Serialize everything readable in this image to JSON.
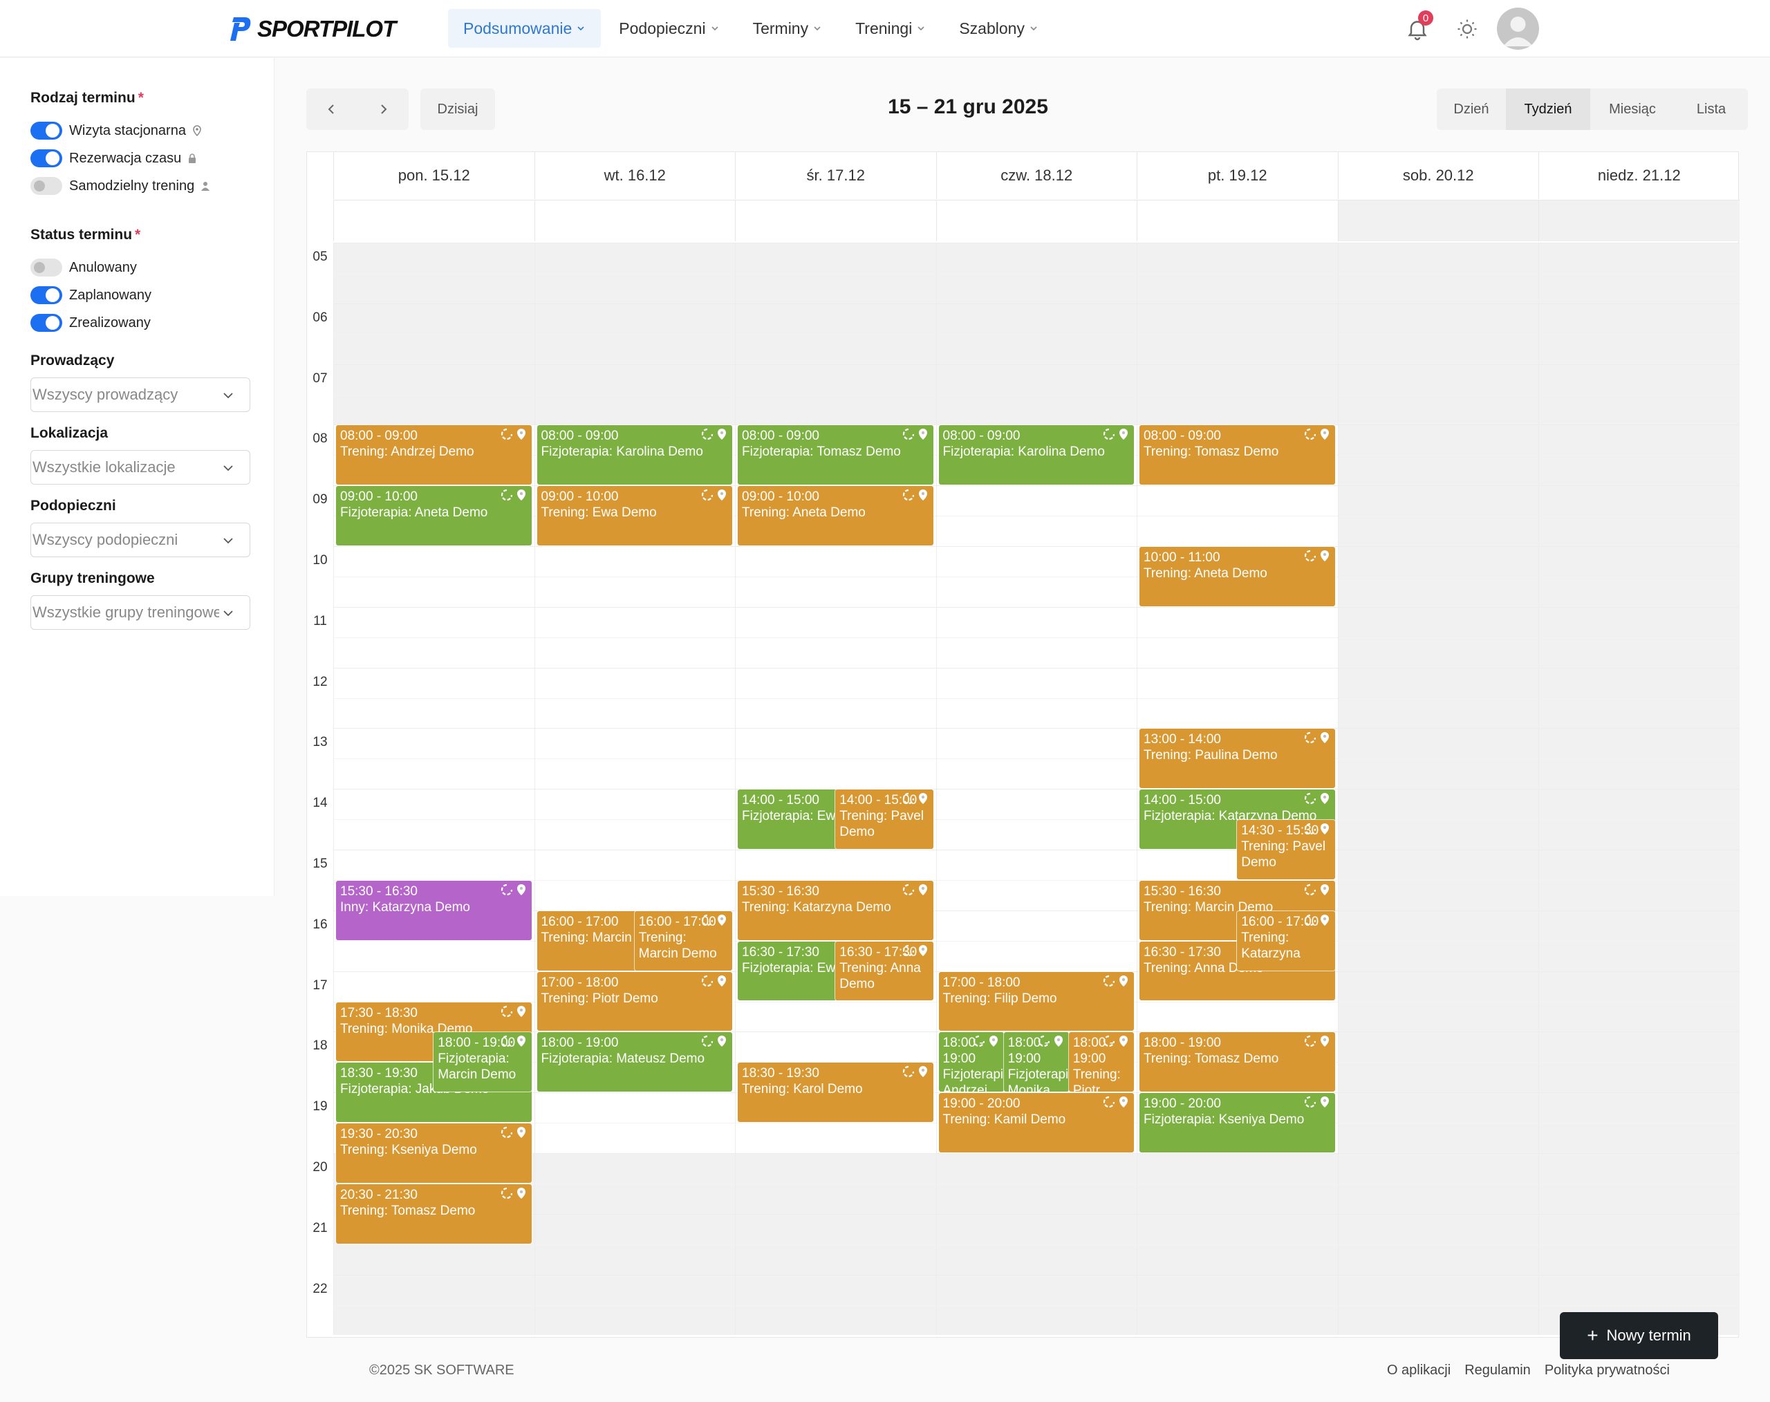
{
  "brand": {
    "name": "SPORTPILOT",
    "color": "#1b6ff0"
  },
  "nav": [
    {
      "label": "Podsumowanie",
      "active": true
    },
    {
      "label": "Podopieczni",
      "active": false
    },
    {
      "label": "Terminy",
      "active": false
    },
    {
      "label": "Treningi",
      "active": false
    },
    {
      "label": "Szablony",
      "active": false
    }
  ],
  "header": {
    "notifications_count": "0",
    "icons": [
      "bell-icon",
      "sun-icon",
      "avatar"
    ]
  },
  "sidebar": {
    "type_title": "Rodzaj terminu",
    "required_mark": "*",
    "types": [
      {
        "label": "Wizyta stacjonarna",
        "on": true,
        "icon": "location-pin-icon"
      },
      {
        "label": "Rezerwacja czasu",
        "on": true,
        "icon": "lock-icon"
      },
      {
        "label": "Samodzielny trening",
        "on": false,
        "icon": "person-icon"
      }
    ],
    "status_title": "Status terminu",
    "statuses": [
      {
        "label": "Anulowany",
        "on": false
      },
      {
        "label": "Zaplanowany",
        "on": true
      },
      {
        "label": "Zrealizowany",
        "on": true
      }
    ],
    "filters": [
      {
        "title": "Prowadzący",
        "placeholder": "Wszyscy prowadzący"
      },
      {
        "title": "Lokalizacja",
        "placeholder": "Wszystkie lokalizacje"
      },
      {
        "title": "Podopieczni",
        "placeholder": "Wszyscy podopieczni"
      },
      {
        "title": "Grupy treningowe",
        "placeholder": "Wszystkie grupy treningowe"
      }
    ]
  },
  "toolbar": {
    "today": "Dzisiaj",
    "range": "15 – 21 gru 2025",
    "views": [
      "Dzień",
      "Tydzień",
      "Miesiąc",
      "Lista"
    ],
    "active_view": "Tydzień"
  },
  "calendar": {
    "days": [
      "pon. 15.12",
      "wt. 16.12",
      "śr. 17.12",
      "czw. 18.12",
      "pt. 19.12",
      "sob. 20.12",
      "niedz. 21.12"
    ],
    "hours": [
      "05",
      "06",
      "07",
      "08",
      "09",
      "10",
      "11",
      "12",
      "13",
      "14",
      "15",
      "16",
      "17",
      "18",
      "19",
      "20",
      "21",
      "22"
    ],
    "colors": {
      "orange": "#d89731",
      "green": "#7cb141",
      "purple": "#b565c9"
    },
    "events": [
      {
        "day": 0,
        "start": "08:00",
        "end": "09:00",
        "time": "08:00 - 09:00",
        "name": "Trening: Andrzej Demo",
        "color": "orange",
        "lane": 0,
        "lanes": 1
      },
      {
        "day": 0,
        "start": "09:00",
        "end": "10:00",
        "time": "09:00 - 10:00",
        "name": "Fizjoterapia: Aneta Demo",
        "color": "green",
        "lane": 0,
        "lanes": 1
      },
      {
        "day": 0,
        "start": "15:30",
        "end": "16:30",
        "time": "15:30 - 16:30",
        "name": "Inny: Katarzyna Demo",
        "color": "purple",
        "lane": 0,
        "lanes": 1
      },
      {
        "day": 0,
        "start": "17:30",
        "end": "18:30",
        "time": "17:30 - 18:30",
        "name": "Trening: Monika Demo",
        "color": "orange",
        "lane": 0,
        "lanes": 1
      },
      {
        "day": 0,
        "start": "18:30",
        "end": "19:30",
        "time": "18:30 - 19:30",
        "name": "Fizjoterapia: Jakub Demo",
        "color": "green",
        "lane": 0,
        "lanes": 1
      },
      {
        "day": 0,
        "start": "18:00",
        "end": "19:00",
        "time": "18:00 - 19:00",
        "name": "Fizjoterapia: Marcin Demo",
        "color": "green",
        "lane": 1,
        "lanes": 2
      },
      {
        "day": 0,
        "start": "19:30",
        "end": "20:30",
        "time": "19:30 - 20:30",
        "name": "Trening: Kseniya Demo",
        "color": "orange",
        "lane": 0,
        "lanes": 1
      },
      {
        "day": 0,
        "start": "20:30",
        "end": "21:30",
        "time": "20:30 - 21:30",
        "name": "Trening: Tomasz Demo",
        "color": "orange",
        "lane": 0,
        "lanes": 1
      },
      {
        "day": 1,
        "start": "08:00",
        "end": "09:00",
        "time": "08:00 - 09:00",
        "name": "Fizjoterapia: Karolina Demo",
        "color": "green",
        "lane": 0,
        "lanes": 1
      },
      {
        "day": 1,
        "start": "09:00",
        "end": "10:00",
        "time": "09:00 - 10:00",
        "name": "Trening: Ewa Demo",
        "color": "orange",
        "lane": 0,
        "lanes": 1
      },
      {
        "day": 1,
        "start": "16:00",
        "end": "17:00",
        "time": "16:00 - 17:00",
        "name": "Trening: Marcin Demo",
        "color": "orange",
        "lane": 0,
        "lanes": 2
      },
      {
        "day": 1,
        "start": "16:00",
        "end": "17:00",
        "time": "16:00 - 17:00",
        "name": "Trening: Marcin Demo",
        "color": "orange",
        "lane": 1,
        "lanes": 2
      },
      {
        "day": 1,
        "start": "17:00",
        "end": "18:00",
        "time": "17:00 - 18:00",
        "name": "Trening: Piotr Demo",
        "color": "orange",
        "lane": 0,
        "lanes": 1
      },
      {
        "day": 1,
        "start": "18:00",
        "end": "19:00",
        "time": "18:00 - 19:00",
        "name": "Fizjoterapia: Mateusz Demo",
        "color": "green",
        "lane": 0,
        "lanes": 1
      },
      {
        "day": 2,
        "start": "08:00",
        "end": "09:00",
        "time": "08:00 - 09:00",
        "name": "Fizjoterapia: Tomasz Demo",
        "color": "green",
        "lane": 0,
        "lanes": 1
      },
      {
        "day": 2,
        "start": "09:00",
        "end": "10:00",
        "time": "09:00 - 10:00",
        "name": "Trening: Aneta Demo",
        "color": "orange",
        "lane": 0,
        "lanes": 1
      },
      {
        "day": 2,
        "start": "14:00",
        "end": "15:00",
        "time": "14:00 - 15:00",
        "name": "Fizjoterapia: Ewa Demo",
        "color": "green",
        "lane": 0,
        "lanes": 2
      },
      {
        "day": 2,
        "start": "14:00",
        "end": "15:00",
        "time": "14:00 - 15:00",
        "name": "Trening: Pavel Demo",
        "color": "orange",
        "lane": 1,
        "lanes": 2
      },
      {
        "day": 2,
        "start": "15:30",
        "end": "16:30",
        "time": "15:30 - 16:30",
        "name": "Trening: Katarzyna Demo",
        "color": "orange",
        "lane": 0,
        "lanes": 1
      },
      {
        "day": 2,
        "start": "16:30",
        "end": "17:30",
        "time": "16:30 - 17:30",
        "name": "Fizjoterapia: Ewa Demo",
        "color": "green",
        "lane": 0,
        "lanes": 2
      },
      {
        "day": 2,
        "start": "16:30",
        "end": "17:30",
        "time": "16:30 - 17:30",
        "name": "Trening: Anna Demo",
        "color": "orange",
        "lane": 1,
        "lanes": 2
      },
      {
        "day": 2,
        "start": "18:30",
        "end": "19:30",
        "time": "18:30 - 19:30",
        "name": "Trening: Karol Demo",
        "color": "orange",
        "lane": 0,
        "lanes": 1
      },
      {
        "day": 3,
        "start": "08:00",
        "end": "09:00",
        "time": "08:00 - 09:00",
        "name": "Fizjoterapia: Karolina Demo",
        "color": "green",
        "lane": 0,
        "lanes": 1
      },
      {
        "day": 3,
        "start": "17:00",
        "end": "18:00",
        "time": "17:00 - 18:00",
        "name": "Trening: Filip Demo",
        "color": "orange",
        "lane": 0,
        "lanes": 1
      },
      {
        "day": 3,
        "start": "18:00",
        "end": "19:00",
        "time": "18:00 - 19:00",
        "name": "Fizjoterapia: Andrzej Demo",
        "color": "green",
        "lane": 0,
        "lanes": 3
      },
      {
        "day": 3,
        "start": "18:00",
        "end": "19:00",
        "time": "18:00 - 19:00",
        "name": "Fizjoterapia: Monika Demo",
        "color": "green",
        "lane": 1,
        "lanes": 3
      },
      {
        "day": 3,
        "start": "18:00",
        "end": "19:00",
        "time": "18:00 - 19:00",
        "name": "Trening: Piotr",
        "color": "orange",
        "lane": 2,
        "lanes": 3
      },
      {
        "day": 3,
        "start": "19:00",
        "end": "20:00",
        "time": "19:00 - 20:00",
        "name": "Trening: Kamil Demo",
        "color": "orange",
        "lane": 0,
        "lanes": 1
      },
      {
        "day": 4,
        "start": "08:00",
        "end": "09:00",
        "time": "08:00 - 09:00",
        "name": "Trening: Tomasz Demo",
        "color": "orange",
        "lane": 0,
        "lanes": 1
      },
      {
        "day": 4,
        "start": "10:00",
        "end": "11:00",
        "time": "10:00 - 11:00",
        "name": "Trening: Aneta Demo",
        "color": "orange",
        "lane": 0,
        "lanes": 1
      },
      {
        "day": 4,
        "start": "13:00",
        "end": "14:00",
        "time": "13:00 - 14:00",
        "name": "Trening: Paulina Demo",
        "color": "orange",
        "lane": 0,
        "lanes": 1
      },
      {
        "day": 4,
        "start": "14:00",
        "end": "15:00",
        "time": "14:00 - 15:00",
        "name": "Fizjoterapia: Katarzyna Demo",
        "color": "green",
        "lane": 0,
        "lanes": 1
      },
      {
        "day": 4,
        "start": "14:30",
        "end": "15:30",
        "time": "14:30 - 15:30",
        "name": "Trening: Pavel Demo",
        "color": "orange",
        "lane": 1,
        "lanes": 2
      },
      {
        "day": 4,
        "start": "15:30",
        "end": "16:30",
        "time": "15:30 - 16:30",
        "name": "Trening: Marcin Demo",
        "color": "orange",
        "lane": 0,
        "lanes": 1
      },
      {
        "day": 4,
        "start": "16:00",
        "end": "17:00",
        "time": "16:00 - 17:00",
        "name": "Trening: Katarzyna",
        "color": "orange",
        "lane": 1,
        "lanes": 2
      },
      {
        "day": 4,
        "start": "16:30",
        "end": "17:30",
        "time": "16:30 - 17:30",
        "name": "Trening: Anna Demo",
        "color": "orange",
        "lane": 0,
        "lanes": 1
      },
      {
        "day": 4,
        "start": "18:00",
        "end": "19:00",
        "time": "18:00 - 19:00",
        "name": "Trening: Tomasz Demo",
        "color": "orange",
        "lane": 0,
        "lanes": 1
      },
      {
        "day": 4,
        "start": "19:00",
        "end": "20:00",
        "time": "19:00 - 20:00",
        "name": "Fizjoterapia: Kseniya Demo",
        "color": "green",
        "lane": 0,
        "lanes": 1
      }
    ]
  },
  "actions": {
    "new_event": "Nowy termin"
  },
  "footer": {
    "copyright": "©2025  SK SOFTWARE",
    "links": [
      "O aplikacji",
      "Regulamin",
      "Polityka prywatności"
    ]
  }
}
